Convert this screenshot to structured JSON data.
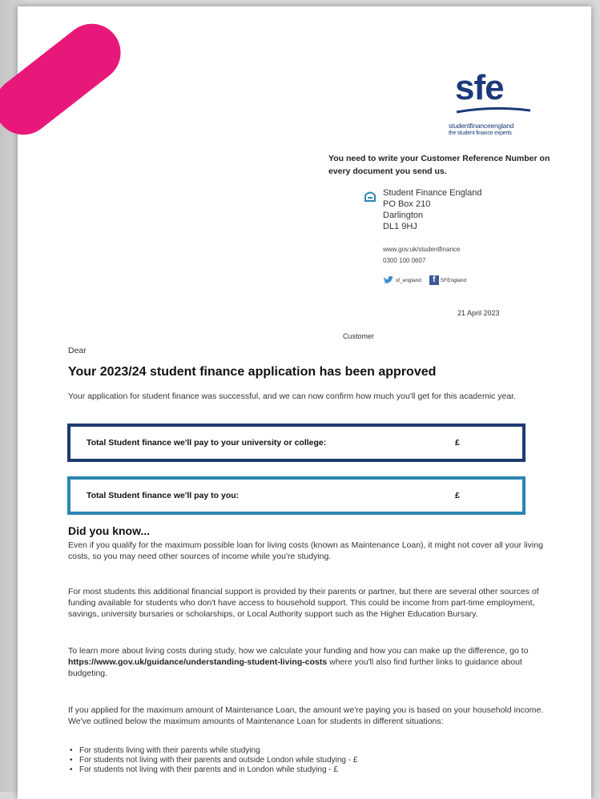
{
  "logo": {
    "mark": "sfe",
    "line1": "studentfinanceengland",
    "line2": "the student finance experts"
  },
  "notice": "You need to write your Customer Reference Number on every document you send us.",
  "address": {
    "icon": "mailbox-icon",
    "lines": [
      "Student Finance England",
      "PO Box 210",
      "Darlington",
      "DL1 9HJ"
    ]
  },
  "contact": {
    "website": "www.gov.uk/studentfinance",
    "phone": "0300 100 0607"
  },
  "social": {
    "twitter": "sf_england",
    "facebook": "SFEngland"
  },
  "date": "21 April 2023",
  "customer_label": "Customer",
  "salutation": "Dear",
  "title": "Your 2023/24 student finance application has been approved",
  "intro": "Your application for student finance was successful, and we can now confirm how much you'll get for this academic year.",
  "boxes": [
    {
      "label": "Total Student finance we'll pay to your university or college:",
      "currency": "£"
    },
    {
      "label": "Total Student finance we'll pay to you:",
      "currency": "£"
    }
  ],
  "did_you_know": {
    "heading": "Did you know...",
    "p1": "Even if you qualify for the maximum possible loan for living costs (known as Maintenance Loan), it might not cover all your living costs, so you may need other sources of income while you're studying.",
    "p2": "For most students this additional financial support is provided by their parents or partner, but there are several other sources of funding available for students who don't have access to household support. This could be income from part-time employment, savings, university bursaries or scholarships, or Local Authority support such as the Higher Education Bursary.",
    "p3_pre": "To learn more about living costs during study, how we calculate your funding and how you can make up the difference, go to",
    "p3_link": "https://www.gov.uk/guidance/understanding-student-living-costs",
    "p3_post": " where you'll also find further links to guidance about budgeting.",
    "p4": "If you applied for the maximum amount of Maintenance Loan, the amount we're paying you is based on your household income. We've outlined below the maximum amounts of Maintenance Loan for students in different situations:",
    "bullets": [
      "For students living with their parents while studying",
      "For students not living with their parents and outside London while studying - £",
      "For students not living with their parents and in London while studying - £"
    ]
  },
  "colors": {
    "accent_pink": "#e8187a",
    "box1_border": "#1f3a72",
    "box2_border": "#2b86b3",
    "logo_blue": "#1b3a7a"
  }
}
